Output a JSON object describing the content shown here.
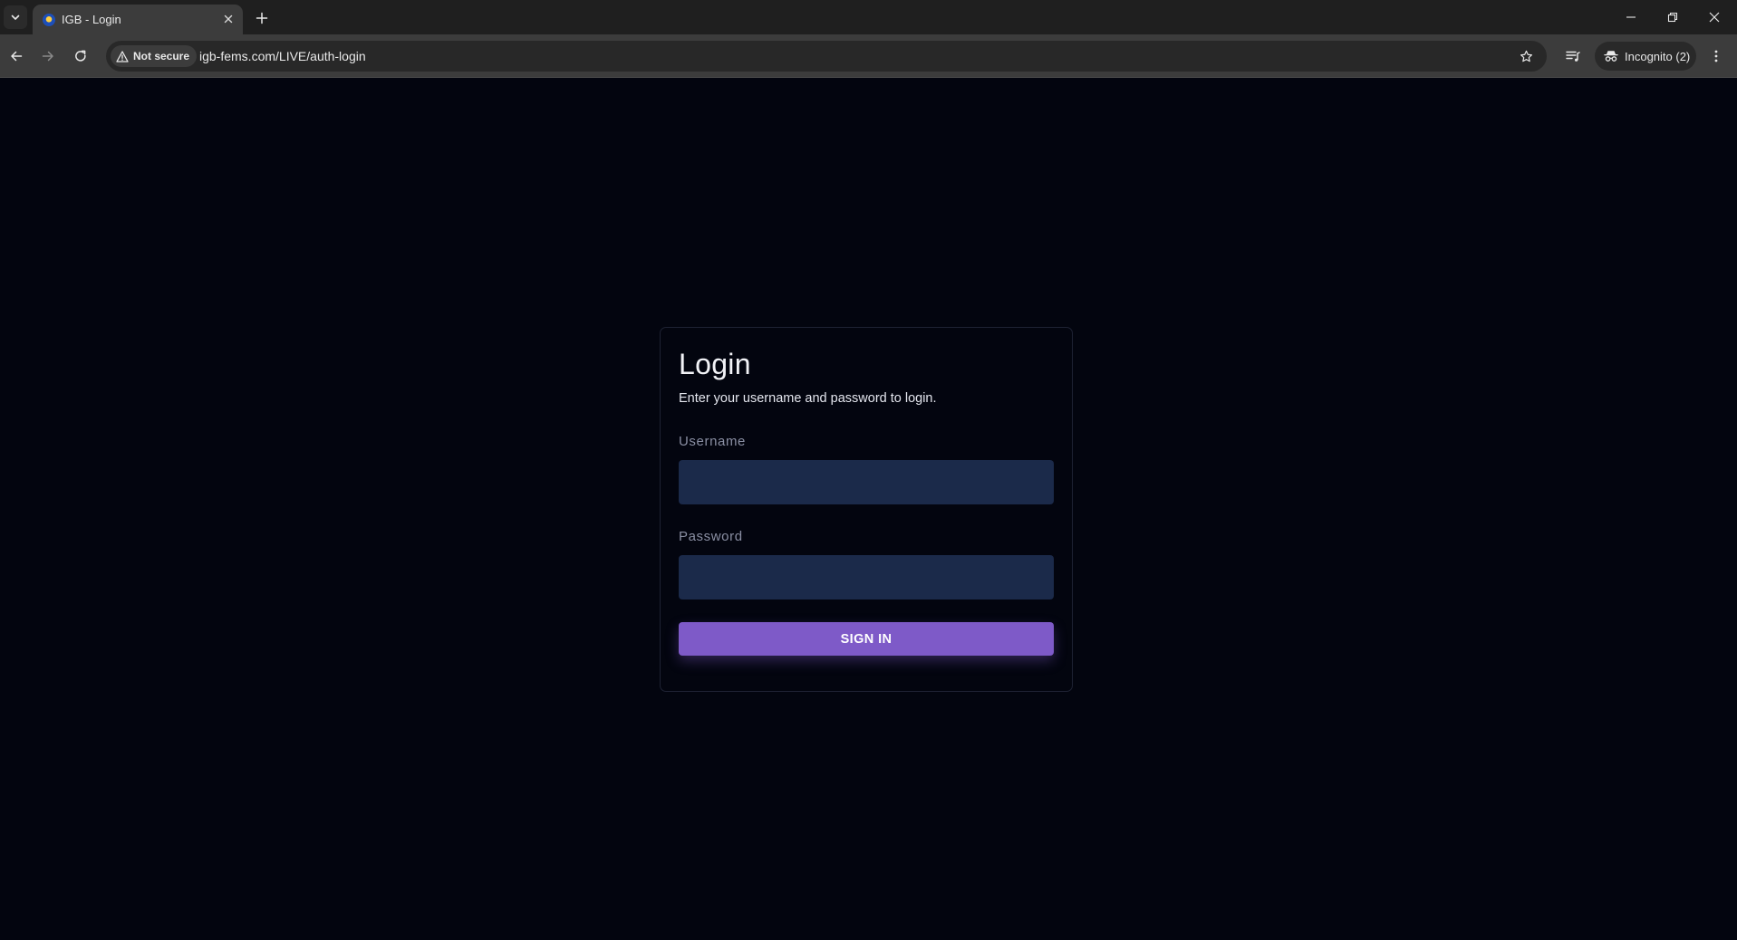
{
  "browser": {
    "tab": {
      "title": "IGB - Login",
      "favicon": "site-favicon"
    },
    "address_bar": {
      "security_label": "Not secure",
      "url": "igb-fems.com/LIVE/auth-login"
    },
    "profile": {
      "label": "Incognito (2)"
    },
    "icons": {
      "tab_list": "chevron-down-icon",
      "tab_close": "close-icon",
      "new_tab": "plus-icon",
      "back": "arrow-left-icon",
      "forward": "arrow-right-icon",
      "reload": "reload-icon",
      "warning": "warning-triangle-icon",
      "bookmark": "star-icon",
      "media": "media-queue-icon",
      "incognito": "incognito-icon",
      "menu": "kebab-menu-icon",
      "minimize": "minimize-icon",
      "restore": "restore-icon",
      "close_window": "close-icon"
    }
  },
  "login": {
    "title": "Login",
    "subtitle": "Enter your username and password to login.",
    "username": {
      "label": "Username",
      "value": "",
      "placeholder": ""
    },
    "password": {
      "label": "Password",
      "value": "",
      "placeholder": ""
    },
    "submit_label": "SIGN IN"
  },
  "colors": {
    "page_background": "#03050f",
    "input_background": "#1b2a4a",
    "button_accent": "#7e5ac8",
    "chrome_tab": "#3c3c3c",
    "chrome_frame": "#1f1f1f"
  }
}
